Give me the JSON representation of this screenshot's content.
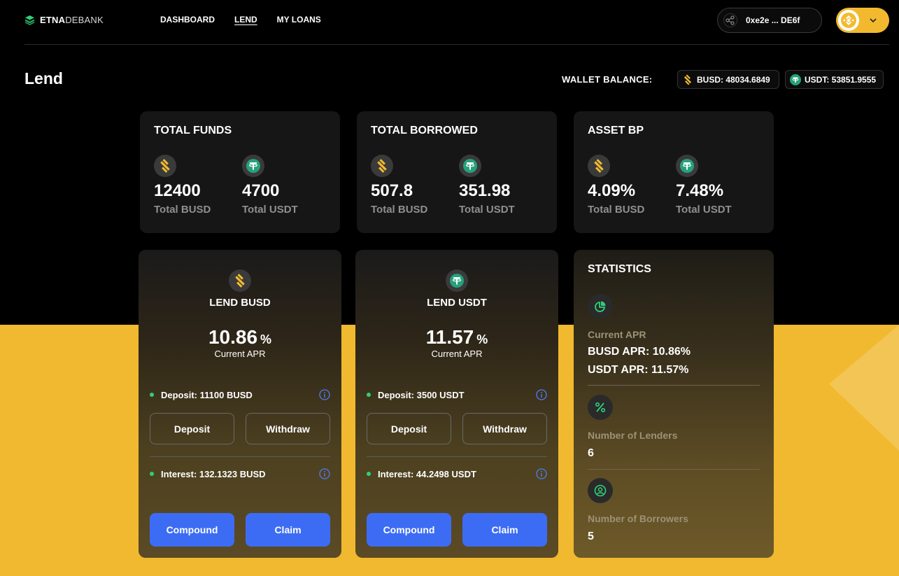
{
  "brand": {
    "bold": "ETNA",
    "light": "DEBANK"
  },
  "nav": {
    "items": [
      {
        "label": "DASHBOARD"
      },
      {
        "label": "LEND"
      },
      {
        "label": "MY LOANS"
      }
    ]
  },
  "wallet": {
    "address": "0xe2e ... DE6f"
  },
  "colors": {
    "accent_yellow": "#f1b92f",
    "busd": "#f3ba2f",
    "usdt": "#26a17b",
    "button_blue": "#3d6cf4",
    "dot_green": "#2fd07a"
  },
  "page": {
    "title": "Lend"
  },
  "wallet_balance": {
    "label": "WALLET BALANCE:",
    "busd": "BUSD: 48034.6849",
    "usdt": "USDT: 53851.9555"
  },
  "summary_cards": [
    {
      "title": "TOTAL FUNDS",
      "metrics": [
        {
          "icon": "busd-icon",
          "value": "12400",
          "label": "Total BUSD"
        },
        {
          "icon": "usdt-icon",
          "value": "4700",
          "label": "Total USDT"
        }
      ]
    },
    {
      "title": "TOTAL BORROWED",
      "metrics": [
        {
          "icon": "busd-icon",
          "value": "507.8",
          "label": "Total BUSD"
        },
        {
          "icon": "usdt-icon",
          "value": "351.98",
          "label": "Total USDT"
        }
      ]
    },
    {
      "title": "ASSET BP",
      "metrics": [
        {
          "icon": "busd-icon",
          "value": "4.09%",
          "label": "Total BUSD"
        },
        {
          "icon": "usdt-icon",
          "value": "7.48%",
          "label": "Total USDT"
        }
      ]
    }
  ],
  "lend_cards": [
    {
      "title": "LEND BUSD",
      "apr": "10.86",
      "apr_unit": "%",
      "apr_label": "Current APR",
      "deposit": "Deposit: 11100 BUSD",
      "interest": "Interest: 132.1323 BUSD",
      "deposit_btn": "Deposit",
      "withdraw_btn": "Withdraw",
      "compound_btn": "Compound",
      "claim_btn": "Claim"
    },
    {
      "title": "LEND USDT",
      "apr": "11.57",
      "apr_unit": "%",
      "apr_label": "Current APR",
      "deposit": "Deposit: 3500 USDT",
      "interest": "Interest: 44.2498 USDT",
      "deposit_btn": "Deposit",
      "withdraw_btn": "Withdraw",
      "compound_btn": "Compound",
      "claim_btn": "Claim"
    }
  ],
  "statistics": {
    "title": "STATISTICS",
    "apr_label": "Current APR",
    "busd_apr": "BUSD APR: 10.86%",
    "usdt_apr": "USDT APR: 11.57%",
    "lenders_label": "Number of Lenders",
    "lenders_value": "6",
    "borrowers_label": "Number of Borrowers",
    "borrowers_value": "5"
  }
}
